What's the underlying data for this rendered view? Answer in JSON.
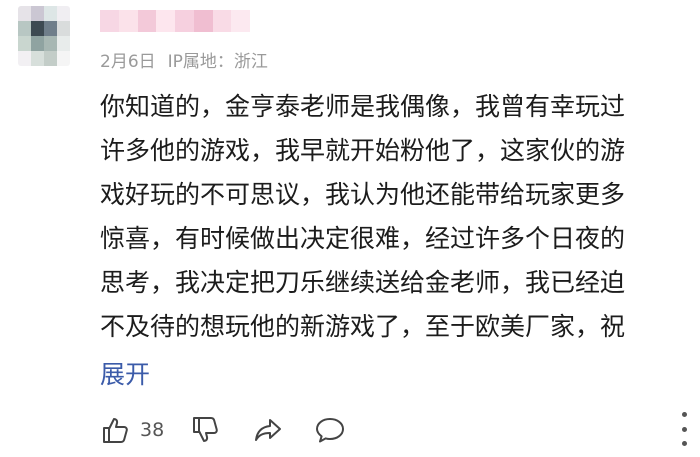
{
  "comment": {
    "avatar_colors": [
      "#e6e3e8",
      "#cbc7d3",
      "#dde6e6",
      "#f0eef2",
      "#b8c7c3",
      "#3d4a52",
      "#6f7e8a",
      "#d9dcdc",
      "#c9d6cf",
      "#8fa3a1",
      "#a7b7b3",
      "#e8eceb",
      "#f2f0f3",
      "#d7dfdb",
      "#c3cdc8",
      "#f5f5f5"
    ],
    "username_blur_colors": [
      "#f7d7e4",
      "#fbe2ea",
      "#f3c9d9",
      "#fde6ee",
      "#f6d0df",
      "#f0bed1",
      "#f9dbe6",
      "#fce9f0"
    ],
    "date": "2月6日",
    "ip_location": "IP属地：浙江",
    "lines": [
      "你知道的，金亨泰老师是我偶像，我曾有幸玩过",
      "许多他的游戏，我早就开始粉他了，这家伙的游",
      "戏好玩的不可思议，我认为他还能带给玩家更多",
      "惊喜，有时候做出决定很难，经过许多个日夜的",
      "思考，我决定把刀乐继续送给金老师，我已经迫",
      "不及待的想玩他的新游戏了，至于欧美厂家，祝"
    ],
    "expand_label": "展开",
    "like_count": "38",
    "icon_names": [
      "thumbs-up-icon",
      "thumbs-down-icon",
      "share-icon",
      "reply-icon",
      "more-icon"
    ],
    "accent_color": "#3b5ba9"
  }
}
